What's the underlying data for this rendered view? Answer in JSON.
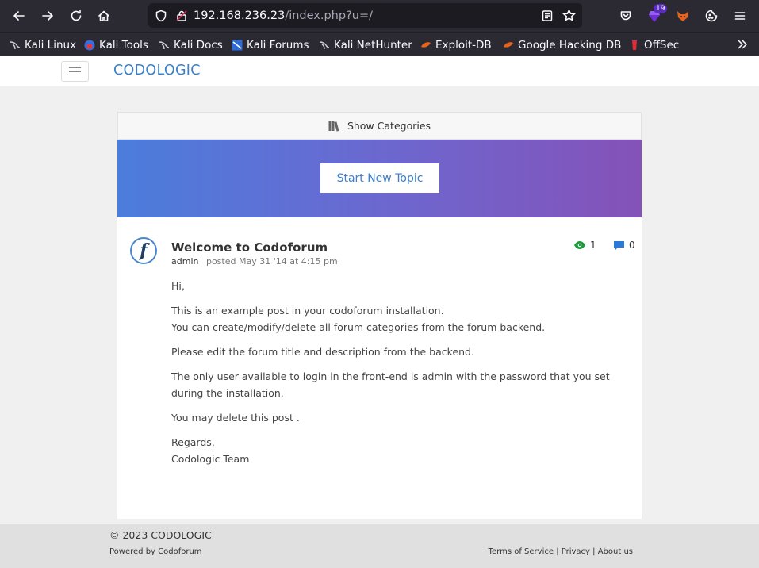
{
  "browser": {
    "url_host": "192.168.236.23",
    "url_path": "/index.php?u=/",
    "extension_badge": "19"
  },
  "bookmarks": [
    {
      "label": "Kali Linux",
      "icon": "kali-dragon-icon"
    },
    {
      "label": "Kali Tools",
      "icon": "kali-tools-icon"
    },
    {
      "label": "Kali Docs",
      "icon": "kali-dragon-icon"
    },
    {
      "label": "Kali Forums",
      "icon": "kali-forums-icon"
    },
    {
      "label": "Kali NetHunter",
      "icon": "kali-dragon-icon"
    },
    {
      "label": "Exploit-DB",
      "icon": "exploit-db-icon"
    },
    {
      "label": "Google Hacking DB",
      "icon": "exploit-db-icon"
    },
    {
      "label": "OffSec",
      "icon": "offsec-icon"
    }
  ],
  "site": {
    "brand": "CODOLOGIC",
    "show_categories": "Show Categories",
    "start_new_topic": "Start New Topic"
  },
  "post": {
    "title": "Welcome to Codoforum",
    "author": "admin",
    "posted": "posted May 31 '14 at 4:15 pm",
    "views": "1",
    "replies": "0",
    "avatar_letter": "f",
    "body": {
      "greeting": "Hi,",
      "line1": "This is an example post in your codoforum installation.",
      "line2": "You can create/modify/delete all forum categories from the forum backend.",
      "line3": "Please edit the forum title and description from the backend.",
      "line4": "The only user available to login in the front-end is admin with the password that you set during the installation.",
      "line5": "You may delete this post .",
      "regards": "Regards,",
      "signature": "Codologic Team"
    }
  },
  "footer": {
    "copyright": "© 2023 CODOLOGIC",
    "powered_prefix": "Powered by ",
    "powered_link": "Codoforum",
    "terms": "Terms of Service",
    "privacy": "Privacy",
    "about": "About us",
    "separator": " | "
  },
  "colors": {
    "brand": "#3a7fc8",
    "hero_start": "#4b7ddc",
    "hero_end": "#8552b8",
    "views_icon": "#1a9c3a",
    "replies_icon": "#2b7bd6"
  }
}
